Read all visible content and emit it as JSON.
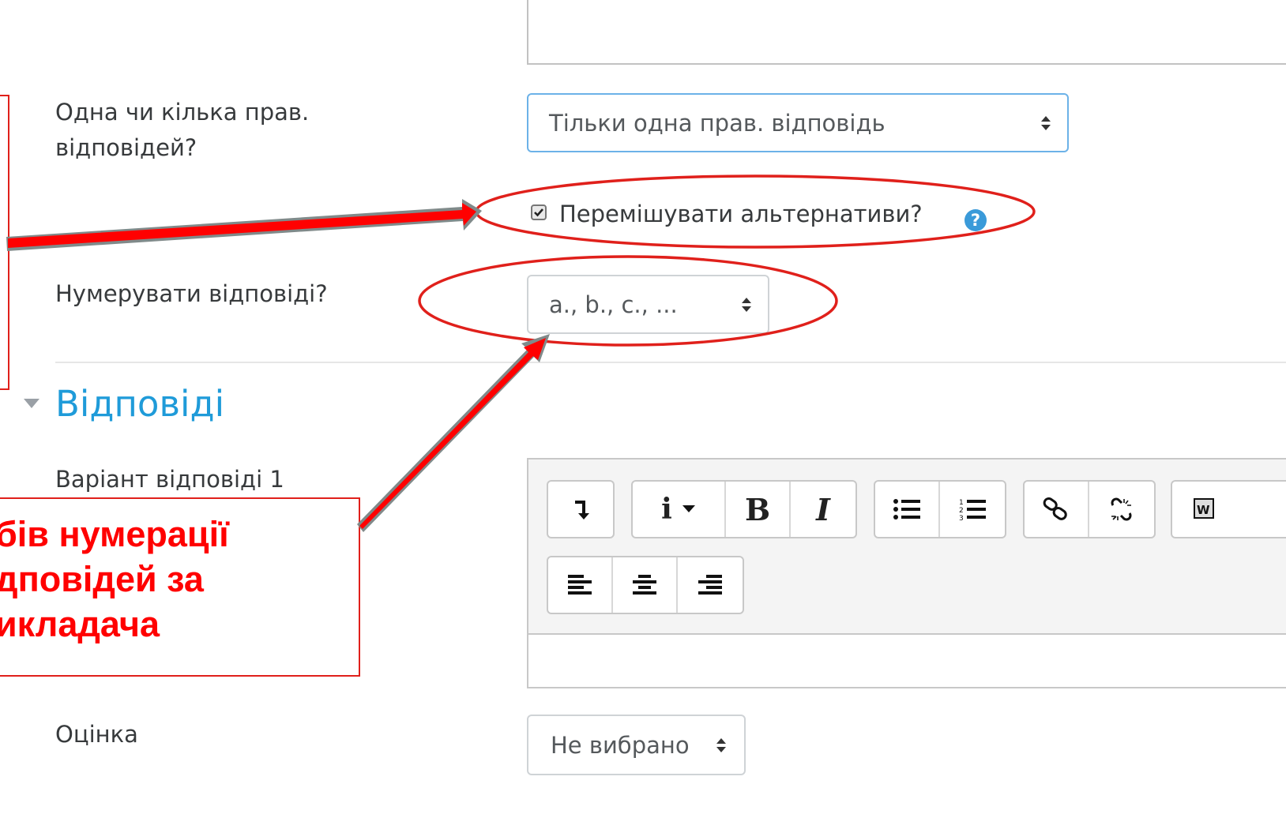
{
  "form": {
    "answers_label_line1": "Одна чи кілька прав.",
    "answers_label_line2": "відповідей?",
    "single_select_value": "Тільки одна прав. відповідь",
    "shuffle_label": "Перемішувати альтернативи?",
    "shuffle_checked": true,
    "help_glyph": "?",
    "numbering_label": "Нумерувати відповіді?",
    "numbering_value": "a., b., c., ...",
    "section_title": "Відповіді",
    "choice_label": "Варіант відповіді 1",
    "grade_label": "Оцінка",
    "grade_value": "Не вибрано"
  },
  "editor": {
    "toolbar_row1": [
      {
        "name": "toggle-toolbar-icon"
      },
      {
        "name": "insert-dropdown-icon"
      },
      {
        "name": "bold-icon"
      },
      {
        "name": "italic-icon"
      },
      {
        "name": "unordered-list-icon"
      },
      {
        "name": "ordered-list-icon"
      },
      {
        "name": "link-icon"
      },
      {
        "name": "unlink-icon"
      },
      {
        "name": "word-paste-icon"
      }
    ],
    "toolbar_row2": [
      {
        "name": "align-left-icon"
      },
      {
        "name": "align-center-icon"
      },
      {
        "name": "align-right-icon"
      }
    ]
  },
  "annotation": {
    "line1": "бів нумерації",
    "line2": "дповідей за",
    "line3": "икладача"
  },
  "colors": {
    "annotation_red": "#ff0000",
    "section_blue": "#1f9bd9",
    "help_blue": "#3a9ad9"
  }
}
